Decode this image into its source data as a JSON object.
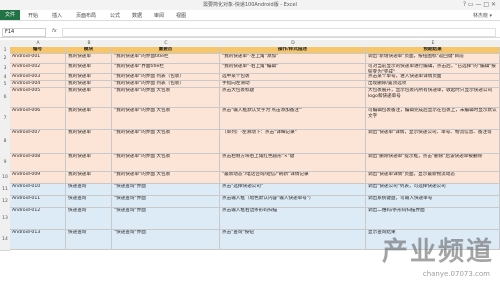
{
  "window": {
    "title": "需要简化对象-快递100Android版 - Excel",
    "controls": "?  ▭  —  □  ✕"
  },
  "ribbon": {
    "tabs": [
      "文件",
      "开始",
      "插入",
      "页面布局",
      "公式",
      "数据",
      "审阅",
      "视图"
    ],
    "user": "林杰晓 ▾"
  },
  "formula": {
    "namebox": "F14",
    "fx": "fx"
  },
  "columns": [
    "A",
    "B",
    "C",
    "D",
    "E"
  ],
  "header": [
    "编号",
    "模块",
    "重要点",
    "操作/样式描述",
    "预期结果"
  ],
  "rows": [
    {
      "num": "1",
      "cells": [
        "编号",
        "模块",
        "重要点",
        "操作/样式描述",
        "预期结果"
      ],
      "style": "hdr"
    },
    {
      "num": "2",
      "cells": [
        "Android-001",
        "我的快递单",
        "\"我的快递单\"的界面title栏",
        "\"我的快递单\"-左上角\"添加\"",
        "调出\"新增快递单\"页面，按钮图标\"返回键\"目前"
      ],
      "style": "orange"
    },
    {
      "num": "3",
      "cells": [
        "Android-002",
        "我的快递单",
        "\"我的快递单\"界面title栏",
        "\"我的快递单\"-右上角\"编辑\"",
        "可对当前显示的快递单进行编辑，点击后，\"已选择\"的\"编辑\"按钮变为\"完成\""
      ],
      "style": "orange"
    },
    {
      "num": "4",
      "cells": [
        "Android-003",
        "我的快递单",
        "\"我的快递单\"的界面 列表（包裹）",
        "选中某个包裹",
        "点击某个单号，进入快递单详情页面"
      ],
      "style": "orange"
    },
    {
      "num": "5",
      "cells": [
        "Android-004",
        "我的快递单",
        "\"我的快递单\"的界面 列表（包裹）",
        "手指向左滑动",
        "出现删除/置顶选项"
      ],
      "style": "orange"
    },
    {
      "num": "6",
      "cells": [
        "Android-005",
        "我的快递单",
        "\"我的快递单\"的界面 大包裹",
        "点击大包裹标题",
        "大包裹展开，显示包裹内所有快递单，收起时只显示快递公司logo和快递单号"
      ],
      "style": "orange"
    },
    {
      "num": "7",
      "cells": [
        "Android-006",
        "我的快递单",
        "\"我的快递单\"的界面 大包裹",
        "点击\"输入框默认文字为'点击添加备注'\"",
        "可编辑包裹备注，编辑完成后显示在包裹上，未编辑时显示默认文字"
      ],
      "style": "orange"
    },
    {
      "num": "8",
      "cells": [
        "Android-007",
        "我的快递单",
        "\"我的快递单\"的界面 大包裹",
        "（单列）-左滑动下：点击\"详细记录\"",
        "调出\"快递单\"详情，显示快递公司、单号、物流信息、备注等"
      ],
      "style": "orange"
    },
    {
      "num": "9",
      "cells": [
        "Android-008",
        "我的快递单",
        "\"我的快递单\"的界面 大包裹",
        "点击右侧方块右上角红色圆形\"×\"键",
        "调出\"删除快递单\"提示框，点击\"删除\"后该快递单被删除"
      ],
      "style": "orange"
    },
    {
      "num": "10",
      "cells": [
        "Android-009",
        "我的快递单",
        "\"我的快递单\"的界面 大包裹",
        "\"最新动态\"/电话咨询/短信/\"刷新\"详情记录",
        "调出\"快递单详情\"页面，显示最新物流动态"
      ],
      "style": "orange"
    },
    {
      "num": "11",
      "cells": [
        "Android-010",
        "快递查询",
        "\"快递查询\"界面",
        "点击\"选择快递公司\"",
        "调出\"快递公司\"列表，可选择快递公司"
      ],
      "style": "blue"
    },
    {
      "num": "12",
      "cells": [
        "Android-011",
        "快递查询",
        "\"快递查询\"界面",
        "点击输入框（暗色默认内容\"输入快递单号\"）",
        "调出系统键盘，可输入快递单号"
      ],
      "style": "blue"
    },
    {
      "num": "13",
      "cells": [
        "Android-012",
        "快递查询",
        "\"快递查询\"界面",
        "点击输入框右边条形码扫描",
        "调出二维码/条形码扫描界面"
      ],
      "style": "blue"
    },
    {
      "num": "14",
      "cells": [
        "Android-013",
        "快递查询",
        "\"快递查询\"界面",
        "点击\"查询\"按钮",
        "显示查询结果"
      ],
      "style": "blue"
    }
  ],
  "watermark": {
    "text": "产业频道",
    "url": "chanye.07073.com"
  }
}
